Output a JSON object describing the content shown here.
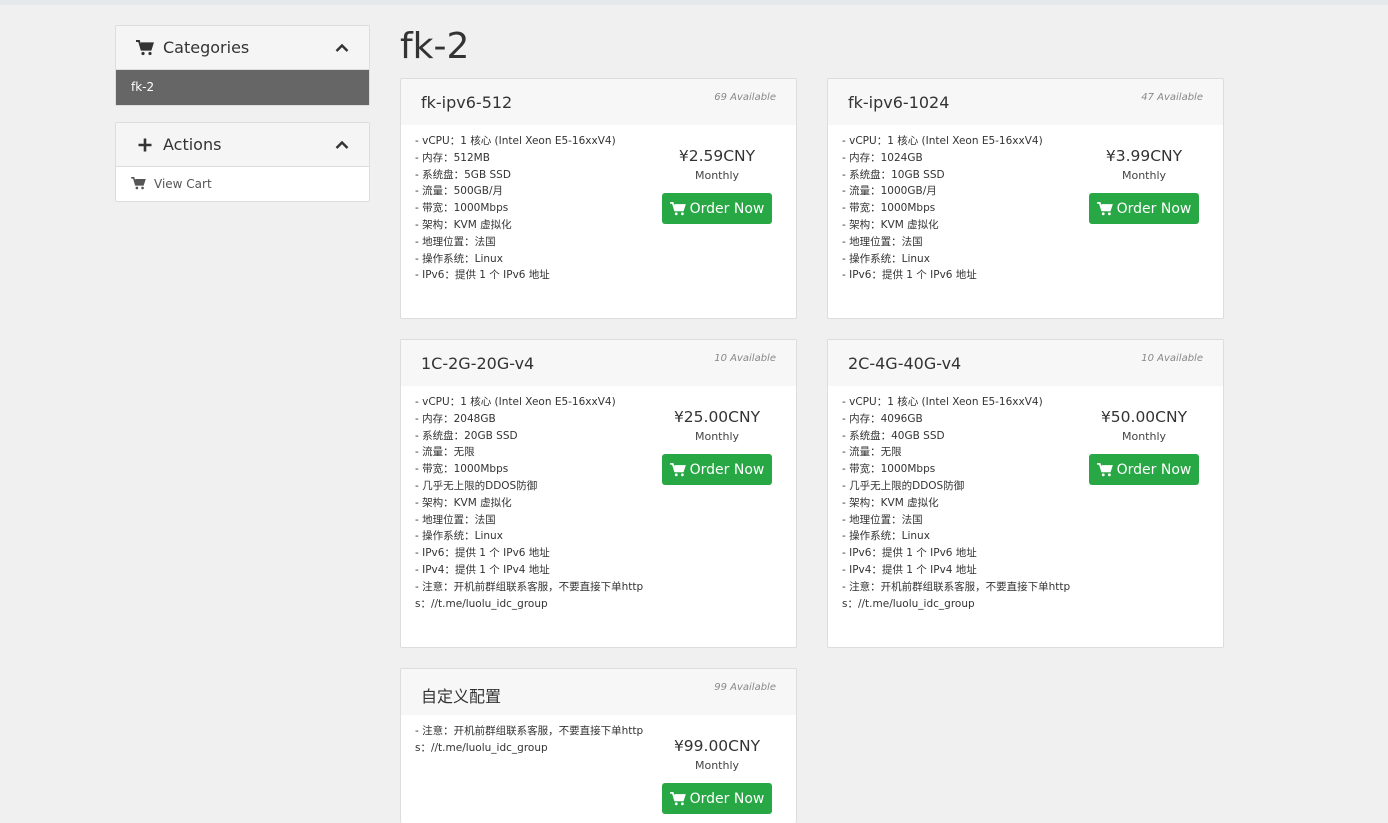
{
  "sidebar": {
    "categories": {
      "title": "Categories",
      "items": [
        {
          "label": "fk-2",
          "active": true
        }
      ]
    },
    "actions": {
      "title": "Actions",
      "items": [
        {
          "label": "View Cart"
        }
      ]
    }
  },
  "main": {
    "title": "fk-2",
    "products": [
      {
        "name": "fk-ipv6-512",
        "available": "69 Available",
        "description": "- vCPU：1 核心 (Intel Xeon E5-16xxV4)\n- 内存：512MB\n- 系统盘：5GB SSD\n- 流量：500GB/月\n- 带宽：1000Mbps\n- 架构：KVM 虚拟化\n- 地理位置：法国\n- 操作系统：Linux\n- IPv6：提供 1 个 IPv6 地址",
        "price": "¥2.59CNY",
        "cycle": "Monthly",
        "button": "Order Now"
      },
      {
        "name": "fk-ipv6-1024",
        "available": "47 Available",
        "description": "- vCPU：1 核心 (Intel Xeon E5-16xxV4)\n- 内存：1024GB\n- 系统盘：10GB SSD\n- 流量：1000GB/月\n- 带宽：1000Mbps\n- 架构：KVM 虚拟化\n- 地理位置：法国\n- 操作系统：Linux\n- IPv6：提供 1 个 IPv6 地址",
        "price": "¥3.99CNY",
        "cycle": "Monthly",
        "button": "Order Now"
      },
      {
        "name": "1C-2G-20G-v4",
        "available": "10 Available",
        "description": "- vCPU：1 核心 (Intel Xeon E5-16xxV4)\n- 内存：2048GB\n- 系统盘：20GB SSD\n- 流量：无限\n- 带宽：1000Mbps\n- 几乎无上限的DDOS防御\n- 架构：KVM 虚拟化\n- 地理位置：法国\n- 操作系统：Linux\n- IPv6：提供 1 个 IPv6 地址\n- IPv4：提供 1 个 IPv4 地址\n- 注意：开机前群组联系客服，不要直接下单https：//t.me/luolu_idc_group",
        "price": "¥25.00CNY",
        "cycle": "Monthly",
        "button": "Order Now"
      },
      {
        "name": "2C-4G-40G-v4",
        "available": "10 Available",
        "description": "- vCPU：1 核心 (Intel Xeon E5-16xxV4)\n- 内存：4096GB\n- 系统盘：40GB SSD\n- 流量：无限\n- 带宽：1000Mbps\n- 几乎无上限的DDOS防御\n- 架构：KVM 虚拟化\n- 地理位置：法国\n- 操作系统：Linux\n- IPv6：提供 1 个 IPv6 地址\n- IPv4：提供 1 个 IPv4 地址\n- 注意：开机前群组联系客服，不要直接下单https：//t.me/luolu_idc_group",
        "price": "¥50.00CNY",
        "cycle": "Monthly",
        "button": "Order Now"
      },
      {
        "name": "自定义配置",
        "available": "99 Available",
        "description": "- 注意：开机前群组联系客服，不要直接下单https：//t.me/luolu_idc_group",
        "price": "¥99.00CNY",
        "cycle": "Monthly",
        "button": "Order Now"
      }
    ]
  },
  "colors": {
    "order_button": "#28a745",
    "active_category": "#666666",
    "page_background": "#f0f0f0"
  },
  "icons": [
    "cart-icon",
    "plus-icon",
    "chevron-up-icon"
  ]
}
